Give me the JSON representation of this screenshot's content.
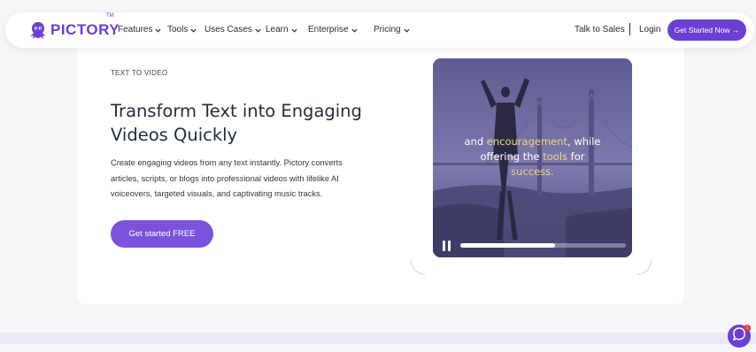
{
  "brand": {
    "name": "PICTORY",
    "tm": "TM",
    "color": "#6b3fd4"
  },
  "nav": {
    "items": [
      {
        "label": "Features",
        "has_dropdown": true
      },
      {
        "label": "Tools",
        "has_dropdown": true
      },
      {
        "label": "Uses Cases",
        "has_dropdown": true
      },
      {
        "label": "Learn",
        "has_dropdown": true
      },
      {
        "label": "Enterprise",
        "has_dropdown": true
      },
      {
        "label": "Pricing",
        "has_dropdown": true
      }
    ],
    "talk_to_sales": "Talk to Sales",
    "separator": "|",
    "login": "Login",
    "cta": "Get Started Now →"
  },
  "hero": {
    "eyebrow": "TEXT TO VIDEO",
    "headline": "Transform Text into Engaging Videos Quickly",
    "description": "Create engaging videos from any text instantly. Pictory converts articles, scripts, or blogs into professional videos with lifelike AI voiceovers, targeted visuals, and captivating music tracks.",
    "button": "Get started FREE"
  },
  "video": {
    "caption_parts": [
      {
        "text": "and ",
        "highlight": false
      },
      {
        "text": "encouragement",
        "highlight": true
      },
      {
        "text": ", while",
        "highlight": false
      },
      {
        "text": "offering the ",
        "highlight": false,
        "break_before": true
      },
      {
        "text": "tools",
        "highlight": true
      },
      {
        "text": " for",
        "highlight": false
      },
      {
        "text": "success.",
        "highlight": true,
        "break_before": true
      }
    ],
    "highlight_color": "#f4d27a",
    "progress": 0.57,
    "state": "playing"
  },
  "chat": {
    "badge": "1"
  },
  "colors": {
    "accent": "#6b3fd4",
    "button": "#7a52dc",
    "page_bg": "#f6f6f8"
  }
}
